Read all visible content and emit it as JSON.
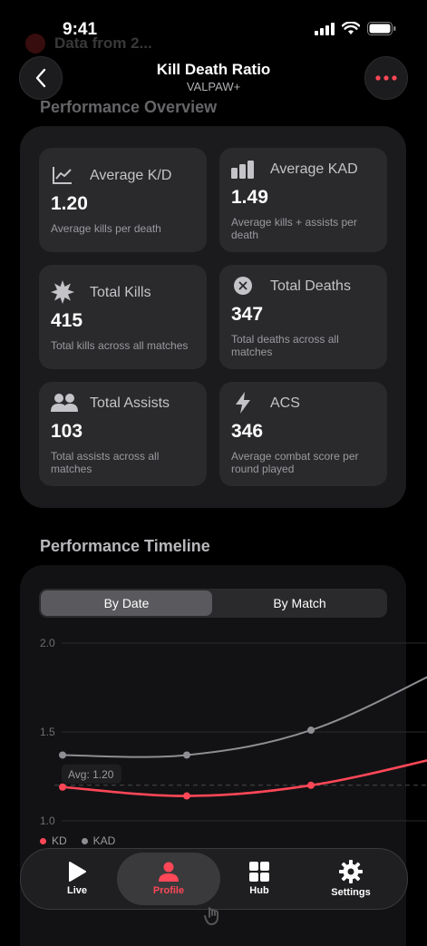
{
  "status": {
    "time": "9:41",
    "banner_text": "Data from 2..."
  },
  "header": {
    "title": "Kill Death Ratio",
    "subtitle": "VALPAW+"
  },
  "overview": {
    "title": "Performance Overview",
    "tiles": [
      {
        "icon": "trend-icon",
        "label": "Average K/D",
        "value": "1.20",
        "desc": "Average kills per death"
      },
      {
        "icon": "bar-chart-icon",
        "label": "Average KAD",
        "value": "1.49",
        "desc": "Average kills + assists per death"
      },
      {
        "icon": "burst-icon",
        "label": "Total Kills",
        "value": "415",
        "desc": "Total kills across all matches"
      },
      {
        "icon": "x-circle-icon",
        "label": "Total Deaths",
        "value": "347",
        "desc": "Total deaths across all matches"
      },
      {
        "icon": "people-icon",
        "label": "Total Assists",
        "value": "103",
        "desc": "Total assists across all matches"
      },
      {
        "icon": "bolt-icon",
        "label": "ACS",
        "value": "346",
        "desc": "Average combat score per round played"
      }
    ]
  },
  "timeline": {
    "title": "Performance Timeline",
    "segments": [
      "By Date",
      "By Match"
    ],
    "selected_segment": "By Date",
    "avg_label": "Avg: 1.20",
    "legend": [
      "KD",
      "KAD"
    ]
  },
  "chart_data": {
    "type": "line",
    "x": [
      1,
      2,
      3,
      4
    ],
    "series": [
      {
        "name": "KD",
        "values": [
          1.19,
          1.14,
          1.2,
          1.35
        ],
        "color": "#ff4757"
      },
      {
        "name": "KAD",
        "values": [
          1.37,
          1.37,
          1.51,
          1.83
        ],
        "color": "#8e8e93"
      }
    ],
    "avg_line": 1.2,
    "yticks": [
      "2.0",
      "1.5",
      "1.0"
    ],
    "ylim": [
      1.0,
      2.0
    ],
    "grid": true,
    "legend_position": "bottom-left"
  },
  "tabbar": {
    "selected": "Profile",
    "tabs": [
      {
        "label": "Live",
        "icon": "play-icon"
      },
      {
        "label": "Profile",
        "icon": "person-icon"
      },
      {
        "label": "Hub",
        "icon": "grid-icon"
      },
      {
        "label": "Settings",
        "icon": "gear-icon"
      }
    ]
  },
  "colors": {
    "accent": "#ff4757",
    "secondary_line": "#8e8e93",
    "card": "#1b1b1d",
    "tile": "#2a2a2c"
  }
}
